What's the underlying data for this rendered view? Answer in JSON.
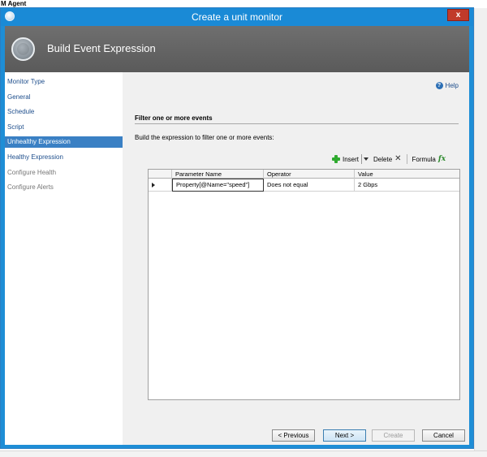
{
  "background_app": {
    "title": "M Agent"
  },
  "window": {
    "title": "Create a unit monitor",
    "close_label": "x"
  },
  "banner": {
    "title": "Build Event Expression"
  },
  "sidebar": {
    "items": [
      {
        "label": "Monitor Type",
        "state": "link"
      },
      {
        "label": "General",
        "state": "link"
      },
      {
        "label": "Schedule",
        "state": "link"
      },
      {
        "label": "Script",
        "state": "link"
      },
      {
        "label": "Unhealthy Expression",
        "state": "active"
      },
      {
        "label": "Healthy Expression",
        "state": "link"
      },
      {
        "label": "Configure Health",
        "state": "disabled"
      },
      {
        "label": "Configure Alerts",
        "state": "disabled"
      }
    ]
  },
  "main": {
    "help_label": "Help",
    "section_title": "Filter one or more events",
    "instruction": "Build the expression to filter one or more events:"
  },
  "toolbar": {
    "insert_label": "Insert",
    "delete_label": "Delete",
    "formula_label": "Formula"
  },
  "grid": {
    "columns": [
      "Parameter Name",
      "Operator",
      "Value"
    ],
    "rows": [
      {
        "parameter": "Property[@Name=\"speed\"]",
        "operator": "Does not equal",
        "value": "2 Gbps"
      }
    ]
  },
  "footer": {
    "previous_label": "< Previous",
    "next_label": "Next >",
    "create_label": "Create",
    "cancel_label": "Cancel"
  },
  "colors": {
    "titlebar": "#1a8ad6",
    "banner": "#626262",
    "active_nav": "#3a80c4",
    "link": "#1e4e8c",
    "panel": "#f0f0f0"
  }
}
